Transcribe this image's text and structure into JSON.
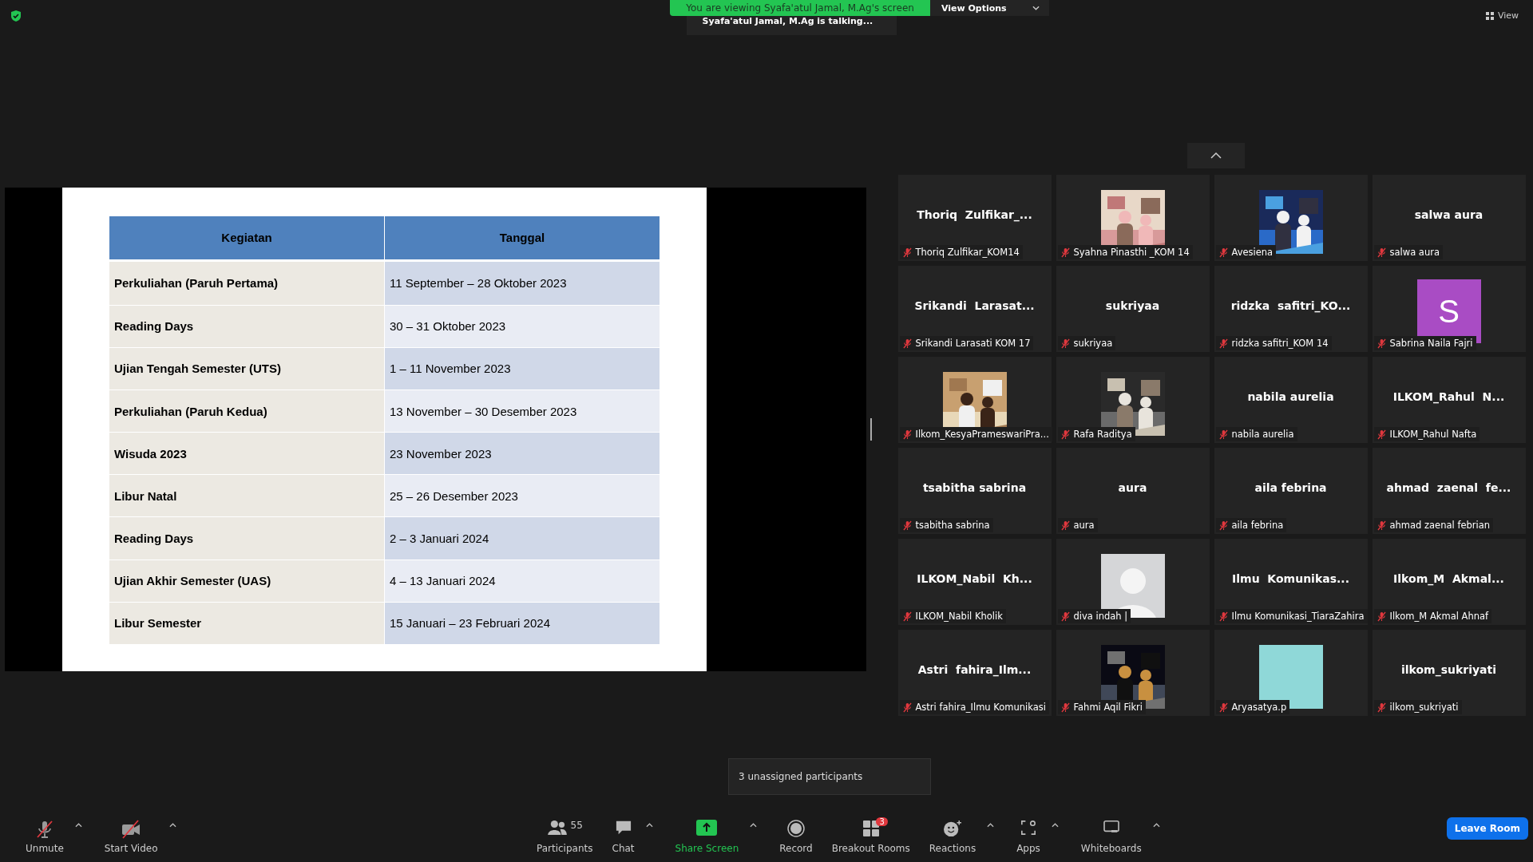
{
  "top_bar": {
    "banner": "You are viewing Syafa'atul Jamal, M.Ag's screen",
    "view_options": "View Options",
    "talking": "Syafa'atul Jamal, M.Ag is talking...",
    "view": "View"
  },
  "slide": {
    "columns": [
      "Kegiatan",
      "Tanggal"
    ],
    "rows": [
      [
        "Perkuliahan (Paruh Pertama)",
        "11 September – 28 Oktober 2023"
      ],
      [
        "Reading Days",
        "30 – 31 Oktober 2023"
      ],
      [
        "Ujian Tengah Semester (UTS)",
        "1 – 11 November 2023"
      ],
      [
        "Perkuliahan (Paruh Kedua)",
        "13 November – 30 Desember 2023"
      ],
      [
        "Wisuda 2023",
        "23 November 2023"
      ],
      [
        "Libur Natal",
        "25 – 26 Desember 2023"
      ],
      [
        "Reading Days",
        "2 – 3 Januari 2024"
      ],
      [
        "Ujian Akhir Semester (UAS)",
        "4 – 13 Januari 2024"
      ],
      [
        "Libur Semester",
        "15 Januari – 23 Februari 2024"
      ]
    ]
  },
  "tiles": [
    {
      "kind": "name",
      "name": "Thoriq  Zulfikar_...",
      "label": "Thoriq Zulfikar_KOM14",
      "muted": true
    },
    {
      "kind": "picture",
      "label": "Syahna Pinasthi _KOM 14",
      "muted": true
    },
    {
      "kind": "picture",
      "label": "Avesiena",
      "muted": true
    },
    {
      "kind": "name",
      "name": "salwa aura",
      "label": "salwa aura",
      "muted": true
    },
    {
      "kind": "name",
      "name": "Srikandi  Larasat...",
      "label": "Srikandi Larasati KOM 17",
      "muted": true
    },
    {
      "kind": "name",
      "name": "sukriyaa",
      "label": "sukriyaa",
      "muted": true
    },
    {
      "kind": "name",
      "name": "ridzka  safitri_KO...",
      "label": "ridzka safitri_KOM 14",
      "muted": true
    },
    {
      "kind": "letter",
      "letter": "S",
      "color": "#a94cc4",
      "label": "Sabrina Naila Fajri",
      "muted": true
    },
    {
      "kind": "picture",
      "label": "Ilkom_KesyaPrameswariPra...",
      "muted": true
    },
    {
      "kind": "picture",
      "label": "Rafa Raditya",
      "muted": true
    },
    {
      "kind": "name",
      "name": "nabila aurelia",
      "label": "nabila aurelia",
      "muted": true
    },
    {
      "kind": "name",
      "name": "ILKOM_Rahul  N...",
      "label": "ILKOM_Rahul Nafta",
      "muted": true
    },
    {
      "kind": "name",
      "name": "tsabitha sabrina",
      "label": "tsabitha sabrina",
      "muted": true
    },
    {
      "kind": "name",
      "name": "aura",
      "label": "aura",
      "muted": true
    },
    {
      "kind": "name",
      "name": "aila febrina",
      "label": "aila febrina",
      "muted": true
    },
    {
      "kind": "name",
      "name": "ahmad  zaenal  fe...",
      "label": "ahmad zaenal febrian",
      "muted": true
    },
    {
      "kind": "name",
      "name": "ILKOM_Nabil  Kh...",
      "label": "ILKOM_Nabil Kholik",
      "muted": true
    },
    {
      "kind": "silhouette",
      "label": "diva indah |",
      "muted": true
    },
    {
      "kind": "name",
      "name": "Ilmu  Komunikas...",
      "label": "Ilmu Komunikasi_TiaraZahira",
      "muted": true
    },
    {
      "kind": "name",
      "name": "Ilkom_M  Akmal...",
      "label": "Ilkom_M Akmal Ahnaf",
      "muted": true
    },
    {
      "kind": "name",
      "name": "Astri  fahira_Ilm...",
      "label": "Astri fahira_Ilmu Komunikasi",
      "muted": true
    },
    {
      "kind": "picture",
      "label": "Fahmi Aqil Fikri",
      "muted": true
    },
    {
      "kind": "swatch",
      "color": "#8fd8d8",
      "label": "Aryasatya.p",
      "muted": true
    },
    {
      "kind": "name",
      "name": "ilkom_sukriyati",
      "label": "ilkom_sukriyati",
      "muted": true
    }
  ],
  "tooltip": "3 unassigned participants",
  "toolbar_left": [
    {
      "kind": "mic",
      "label": "Unmute",
      "caret": true
    },
    {
      "kind": "video",
      "label": "Start Video",
      "caret": true
    }
  ],
  "toolbar_center": [
    {
      "kind": "participants",
      "label": "Participants",
      "count": "55",
      "caret": false
    },
    {
      "kind": "chat",
      "label": "Chat",
      "caret": true
    },
    {
      "kind": "share",
      "label": "Share Screen",
      "caret": true
    },
    {
      "kind": "record",
      "label": "Record",
      "caret": false
    },
    {
      "kind": "breakout",
      "label": "Breakout Rooms",
      "badge": "3",
      "caret": false
    },
    {
      "kind": "reactions",
      "label": "Reactions",
      "caret": true
    },
    {
      "kind": "apps",
      "label": "Apps",
      "caret": true
    },
    {
      "kind": "whiteboard",
      "label": "Whiteboards",
      "caret": true
    }
  ],
  "leave": "Leave Room"
}
